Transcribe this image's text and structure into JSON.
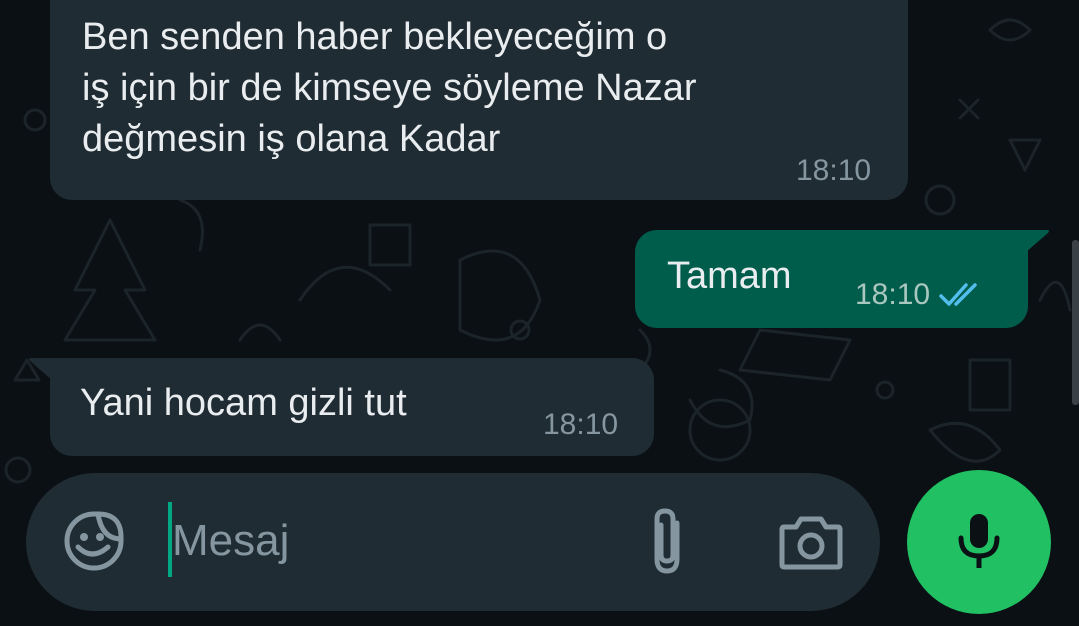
{
  "colors": {
    "background": "#0b1014",
    "incoming_bubble": "#202c33",
    "outgoing_bubble": "#005c4b",
    "text": "#e9edef",
    "meta": "#8696a0",
    "read_ticks": "#53bdeb",
    "accent": "#00a884",
    "mic_button": "#21c063"
  },
  "messages": [
    {
      "direction": "incoming",
      "text": "Ben senden haber bekleyeceğim o\niş için bir de kimseye söyleme Nazar\ndeğmesin iş olana Kadar",
      "time": "18:10"
    },
    {
      "direction": "outgoing",
      "text": "Tamam",
      "time": "18:10",
      "status_icon": "double-check-read-icon"
    },
    {
      "direction": "incoming",
      "text": "Yani hocam gizli tut",
      "time": "18:10"
    }
  ],
  "composer": {
    "placeholder": "Mesaj",
    "value": "",
    "emoji_icon": "sticker-emoji-icon",
    "attach_icon": "paperclip-icon",
    "camera_icon": "camera-icon",
    "send_icon": "microphone-icon"
  }
}
